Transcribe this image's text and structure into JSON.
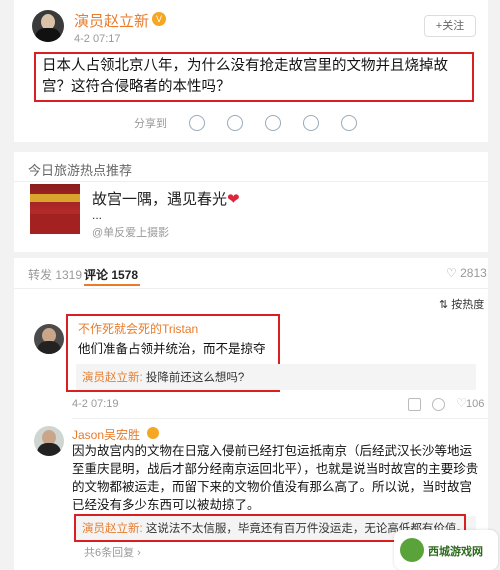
{
  "post": {
    "author": "演员赵立新",
    "time": "4-2 07:17",
    "follow_label": "+关注",
    "text": "日本人占领北京八年，为什么没有抢走故宫里的文物并且烧掉故宫？这符合侵略者的本性吗？",
    "share_label": "分享到",
    "share_icons": [
      "wechat-icon",
      "moments-icon",
      "qq-icon",
      "qzone-icon",
      "favorite-icon"
    ]
  },
  "hot": {
    "title": "今日旅游热点推荐",
    "item_text": "故宫一隅，遇见春光",
    "item_dots": "...",
    "item_sub": "@单反爱上摄影"
  },
  "tabs": {
    "repost": "转发 1319",
    "comment": "评论 1578",
    "like": "2813",
    "sort": "按热度"
  },
  "comments": [
    {
      "name": "不作死就会死的Tristan",
      "text": "他们准备占领并统治，而不是掠夺",
      "reply_name": "演员赵立新:",
      "reply_text": " 投降前还这么想吗?",
      "time": "4-2 07:19",
      "likes": "106"
    },
    {
      "name": "Jason吴宏胜",
      "text": "因为故宫内的文物在日寇入侵前已经打包运抵南京（后经武汉长沙等地运至重庆昆明，战后才部分经南京运回北平），也就是说当时故宫的主要珍贵的文物都被运走，而留下来的文物价值没有那么高了。所以说，当时故宫已经没有多少东西可以被劫掠了。",
      "reply_name": "演员赵立新:",
      "reply_text": " 这说法不太信服，毕竟还有百万件没运走，无论高低都有价值。",
      "more": "共6条回复 ›"
    }
  ],
  "watermark": "西城游戏网"
}
